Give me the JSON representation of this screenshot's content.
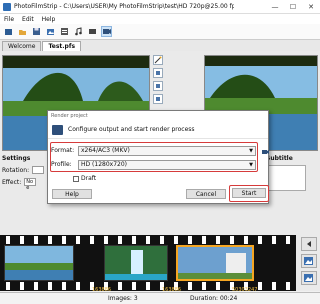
{
  "window": {
    "title": "PhotoFilmStrip - C:\\Users\\USER\\My PhotoFilmStrip\\test\\HD 720p@25.00 fps\\Test\\Test.pfs"
  },
  "menu": [
    "File",
    "Edit",
    "Help"
  ],
  "tabs": [
    {
      "label": "Welcome"
    },
    {
      "label": "Test.pfs"
    }
  ],
  "settings": {
    "heading": "Settings",
    "rotation_label": "Rotation:",
    "effect_label": "Effect:",
    "effect_value": "No e"
  },
  "subtitle": {
    "heading": "Subtitle"
  },
  "filmstrip": {
    "labels": [
      "163886",
      "163886",
      "50303247"
    ]
  },
  "status": {
    "images": "Images: 3",
    "duration": "Duration: 00:24"
  },
  "dialog": {
    "title": "Render project",
    "heading": "Configure output and start render process",
    "format_label": "Format:",
    "format_value": "x264/AC3 (MKV)",
    "profile_label": "Profile:",
    "profile_value": "HD (1280x720)",
    "draft_label": "Draft",
    "help_label": "Help",
    "cancel_label": "Cancel",
    "start_label": "Start"
  },
  "colors": {
    "highlight": "#d63b3b",
    "selection": "#f5a623"
  }
}
